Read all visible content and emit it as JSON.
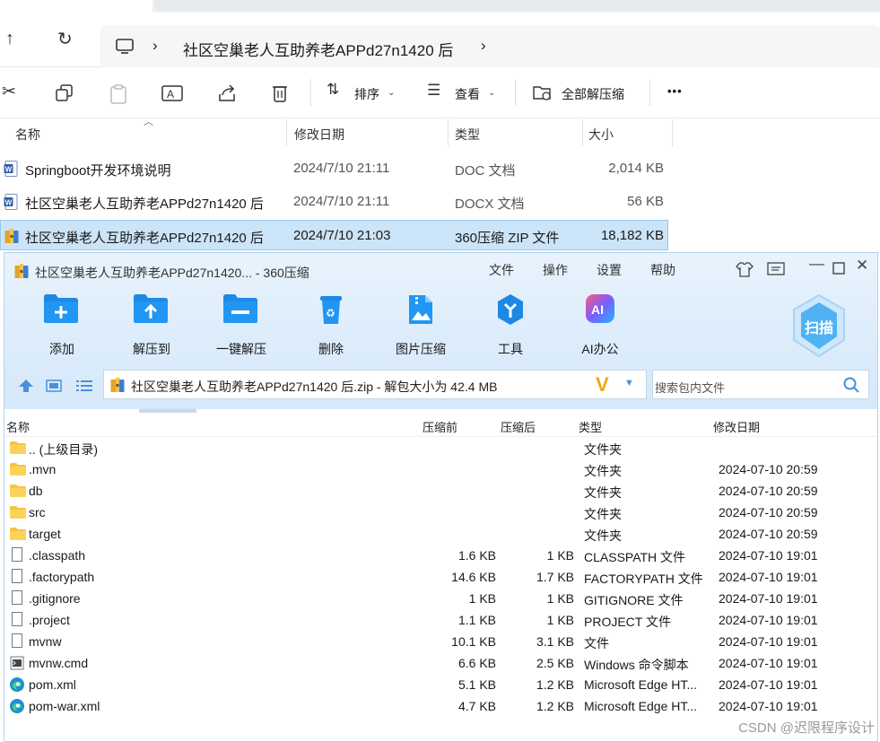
{
  "explorer": {
    "breadcrumb": "社区空巢老人互助养老APPd27n1420 后",
    "toolbar": {
      "sort_label": "排序",
      "view_label": "查看",
      "extract_all_label": "全部解压缩",
      "more_label": "•••"
    },
    "columns": {
      "name": "名称",
      "modified": "修改日期",
      "type": "类型",
      "size": "大小"
    },
    "files": [
      {
        "name": "Springboot开发环境说明",
        "modified": "2024/7/10 21:11",
        "type": "DOC 文档",
        "size": "2,014 KB",
        "icon": "word-doc-icon"
      },
      {
        "name": "社区空巢老人互助养老APPd27n1420 后",
        "modified": "2024/7/10 21:11",
        "type": "DOCX 文档",
        "size": "56 KB",
        "icon": "word-doc-icon"
      },
      {
        "name": "社区空巢老人互助养老APPd27n1420 后",
        "modified": "2024/7/10 21:03",
        "type": "360压缩 ZIP 文件",
        "size": "18,182 KB",
        "icon": "zip-archive-icon",
        "selected": true
      }
    ]
  },
  "zip": {
    "title": "社区空巢老人互助养老APPd27n1420... - 360压缩",
    "menu": [
      "文件",
      "操作",
      "设置",
      "帮助"
    ],
    "buttons": {
      "add": "添加",
      "extract_to": "解压到",
      "one_click": "一键解压",
      "delete": "删除",
      "image_compress": "图片压缩",
      "tools": "工具",
      "ai_office": "AI办公"
    },
    "scan_label": "扫描",
    "path": "社区空巢老人互助养老APPd27n1420 后.zip - 解包大小为 42.4 MB",
    "search_placeholder": "搜索包内文件",
    "columns": {
      "name": "名称",
      "before": "压缩前",
      "after": "压缩后",
      "type": "类型",
      "modified": "修改日期"
    },
    "rows": [
      {
        "name": ".. (上级目录)",
        "before": "",
        "after": "",
        "type": "文件夹",
        "modified": "",
        "icon": "folder"
      },
      {
        "name": ".mvn",
        "before": "",
        "after": "",
        "type": "文件夹",
        "modified": "2024-07-10 20:59",
        "icon": "folder"
      },
      {
        "name": "db",
        "before": "",
        "after": "",
        "type": "文件夹",
        "modified": "2024-07-10 20:59",
        "icon": "folder"
      },
      {
        "name": "src",
        "before": "",
        "after": "",
        "type": "文件夹",
        "modified": "2024-07-10 20:59",
        "icon": "folder"
      },
      {
        "name": "target",
        "before": "",
        "after": "",
        "type": "文件夹",
        "modified": "2024-07-10 20:59",
        "icon": "folder"
      },
      {
        "name": ".classpath",
        "before": "1.6 KB",
        "after": "1 KB",
        "type": "CLASSPATH 文件",
        "modified": "2024-07-10 19:01",
        "icon": "file"
      },
      {
        "name": ".factorypath",
        "before": "14.6 KB",
        "after": "1.7 KB",
        "type": "FACTORYPATH 文件",
        "modified": "2024-07-10 19:01",
        "icon": "file"
      },
      {
        "name": ".gitignore",
        "before": "1 KB",
        "after": "1 KB",
        "type": "GITIGNORE 文件",
        "modified": "2024-07-10 19:01",
        "icon": "file"
      },
      {
        "name": ".project",
        "before": "1.1 KB",
        "after": "1 KB",
        "type": "PROJECT 文件",
        "modified": "2024-07-10 19:01",
        "icon": "file"
      },
      {
        "name": "mvnw",
        "before": "10.1 KB",
        "after": "3.1 KB",
        "type": "文件",
        "modified": "2024-07-10 19:01",
        "icon": "file"
      },
      {
        "name": "mvnw.cmd",
        "before": "6.6 KB",
        "after": "2.5 KB",
        "type": "Windows 命令脚本",
        "modified": "2024-07-10 19:01",
        "icon": "cmd"
      },
      {
        "name": "pom.xml",
        "before": "5.1 KB",
        "after": "1.2 KB",
        "type": "Microsoft Edge HT...",
        "modified": "2024-07-10 19:01",
        "icon": "edge"
      },
      {
        "name": "pom-war.xml",
        "before": "4.7 KB",
        "after": "1.2 KB",
        "type": "Microsoft Edge HT...",
        "modified": "2024-07-10 19:01",
        "icon": "edge"
      }
    ]
  },
  "watermark": "CSDN @迟限程序设计"
}
